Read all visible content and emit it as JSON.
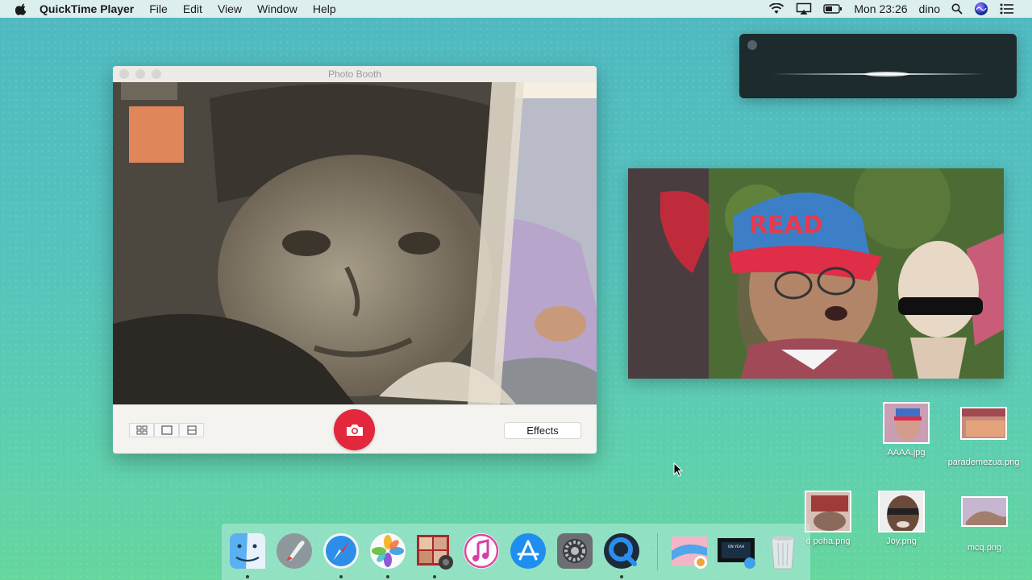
{
  "menubar": {
    "app_name": "QuickTime Player",
    "menus": [
      "File",
      "Edit",
      "View",
      "Window",
      "Help"
    ],
    "clock": "Mon 23:26",
    "user": "dino"
  },
  "photo_booth": {
    "title": "Photo Booth",
    "effects_label": "Effects"
  },
  "desktop_icons": [
    {
      "label": "AAAA.jpg"
    },
    {
      "label": "parademezua.png"
    },
    {
      "label": "d poha.png"
    },
    {
      "label": "Joy.png"
    },
    {
      "label": "mcq.png"
    }
  ],
  "dock": {
    "items": [
      "Finder",
      "Launchpad",
      "Safari",
      "Photos",
      "Photo Booth",
      "iTunes",
      "App Store",
      "System Preferences",
      "QuickTime Player",
      "Image",
      "Screen Recording",
      "Trash"
    ]
  },
  "colors": {
    "shutter": "#e3273c",
    "desktop_top": "#4fb9c0",
    "desktop_bottom": "#66d69e"
  }
}
